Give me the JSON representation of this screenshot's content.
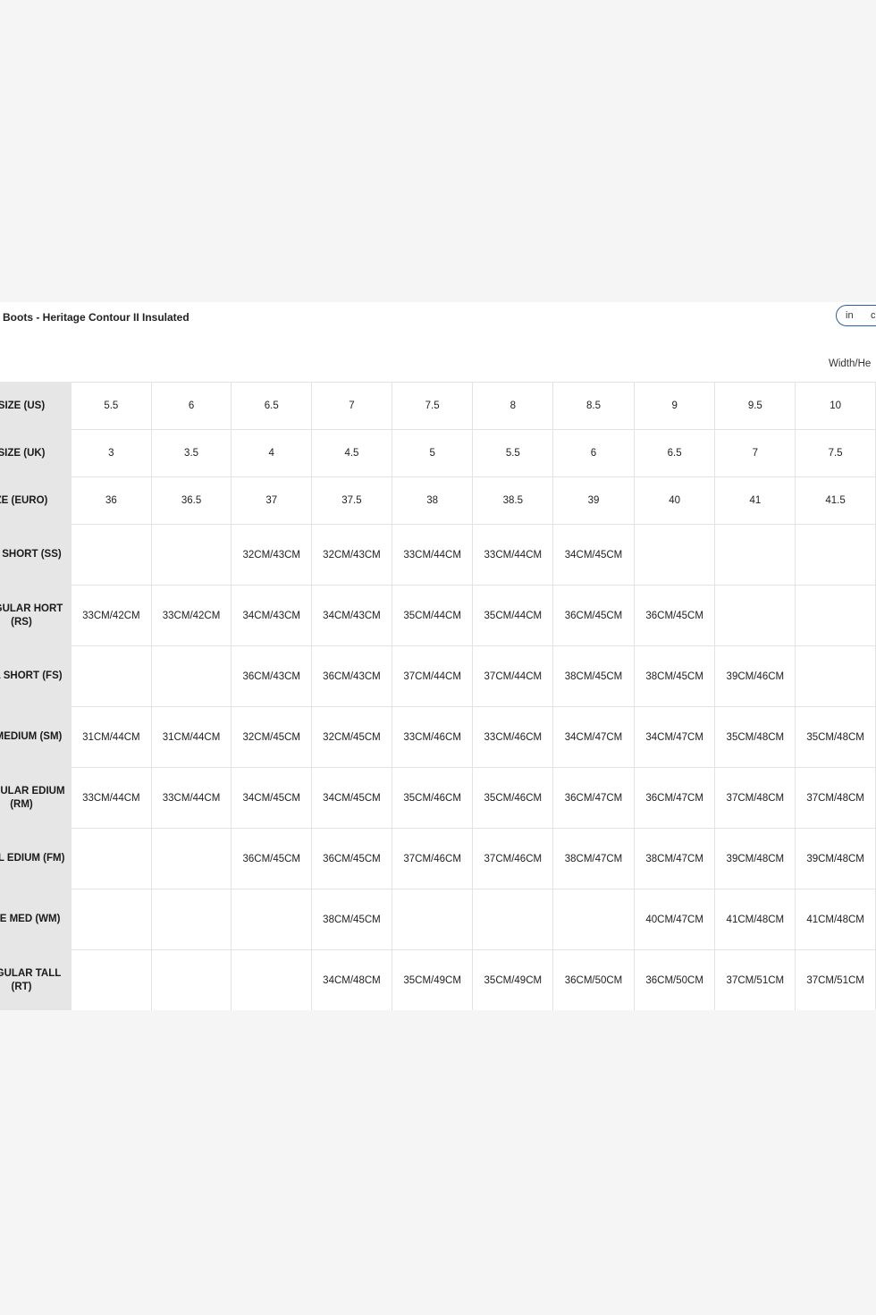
{
  "title": "ll Boots - Heritage Contour II Insulated",
  "unit_toggle": {
    "option_in": "in",
    "option_cm": "c"
  },
  "unit_label": "Width/He",
  "rows": [
    {
      "label": "SIZE (US)",
      "cells": [
        "5.5",
        "6",
        "6.5",
        "7",
        "7.5",
        "8",
        "8.5",
        "9",
        "9.5",
        "10"
      ]
    },
    {
      "label": "SIZE (UK)",
      "cells": [
        "3",
        "3.5",
        "4",
        "4.5",
        "5",
        "5.5",
        "6",
        "6.5",
        "7",
        "7.5"
      ]
    },
    {
      "label": "ZE (EURO)",
      "cells": [
        "36",
        "36.5",
        "37",
        "37.5",
        "38",
        "38.5",
        "39",
        "40",
        "41",
        "41.5"
      ]
    },
    {
      "label": "LIM SHORT (SS)",
      "cells": [
        "",
        "",
        "32CM/43CM",
        "32CM/43CM",
        "33CM/44CM",
        "33CM/44CM",
        "34CM/45CM",
        "",
        "",
        ""
      ]
    },
    {
      "label": "REGULAR HORT (RS)",
      "cells": [
        "33CM/42CM",
        "33CM/42CM",
        "34CM/43CM",
        "34CM/43CM",
        "35CM/44CM",
        "35CM/44CM",
        "36CM/45CM",
        "36CM/45CM",
        "",
        ""
      ]
    },
    {
      "label": "ULL SHORT (FS)",
      "cells": [
        "",
        "",
        "36CM/43CM",
        "36CM/43CM",
        "37CM/44CM",
        "37CM/44CM",
        "38CM/45CM",
        "38CM/45CM",
        "39CM/46CM",
        ""
      ]
    },
    {
      "label": "IM MEDIUM (SM)",
      "cells": [
        "31CM/44CM",
        "31CM/44CM",
        "32CM/45CM",
        "32CM/45CM",
        "33CM/46CM",
        "33CM/46CM",
        "34CM/47CM",
        "34CM/47CM",
        "35CM/48CM",
        "35CM/48CM"
      ]
    },
    {
      "label": "REGULAR EDIUM (RM)",
      "cells": [
        "33CM/44CM",
        "33CM/44CM",
        "34CM/45CM",
        "34CM/45CM",
        "35CM/46CM",
        "35CM/46CM",
        "36CM/47CM",
        "36CM/47CM",
        "37CM/48CM",
        "37CM/48CM"
      ]
    },
    {
      "label": "FULL EDIUM (FM)",
      "cells": [
        "",
        "",
        "36CM/45CM",
        "36CM/45CM",
        "37CM/46CM",
        "37CM/46CM",
        "38CM/47CM",
        "38CM/47CM",
        "39CM/48CM",
        "39CM/48CM"
      ]
    },
    {
      "label": "VIDE MED (WM)",
      "cells": [
        "",
        "",
        "",
        "38CM/45CM",
        "",
        "",
        "",
        "40CM/47CM",
        "41CM/48CM",
        "41CM/48CM"
      ]
    },
    {
      "label": "REGULAR TALL (RT)",
      "cells": [
        "",
        "",
        "",
        "34CM/48CM",
        "35CM/49CM",
        "35CM/49CM",
        "36CM/50CM",
        "36CM/50CM",
        "37CM/51CM",
        "37CM/51CM"
      ]
    }
  ]
}
